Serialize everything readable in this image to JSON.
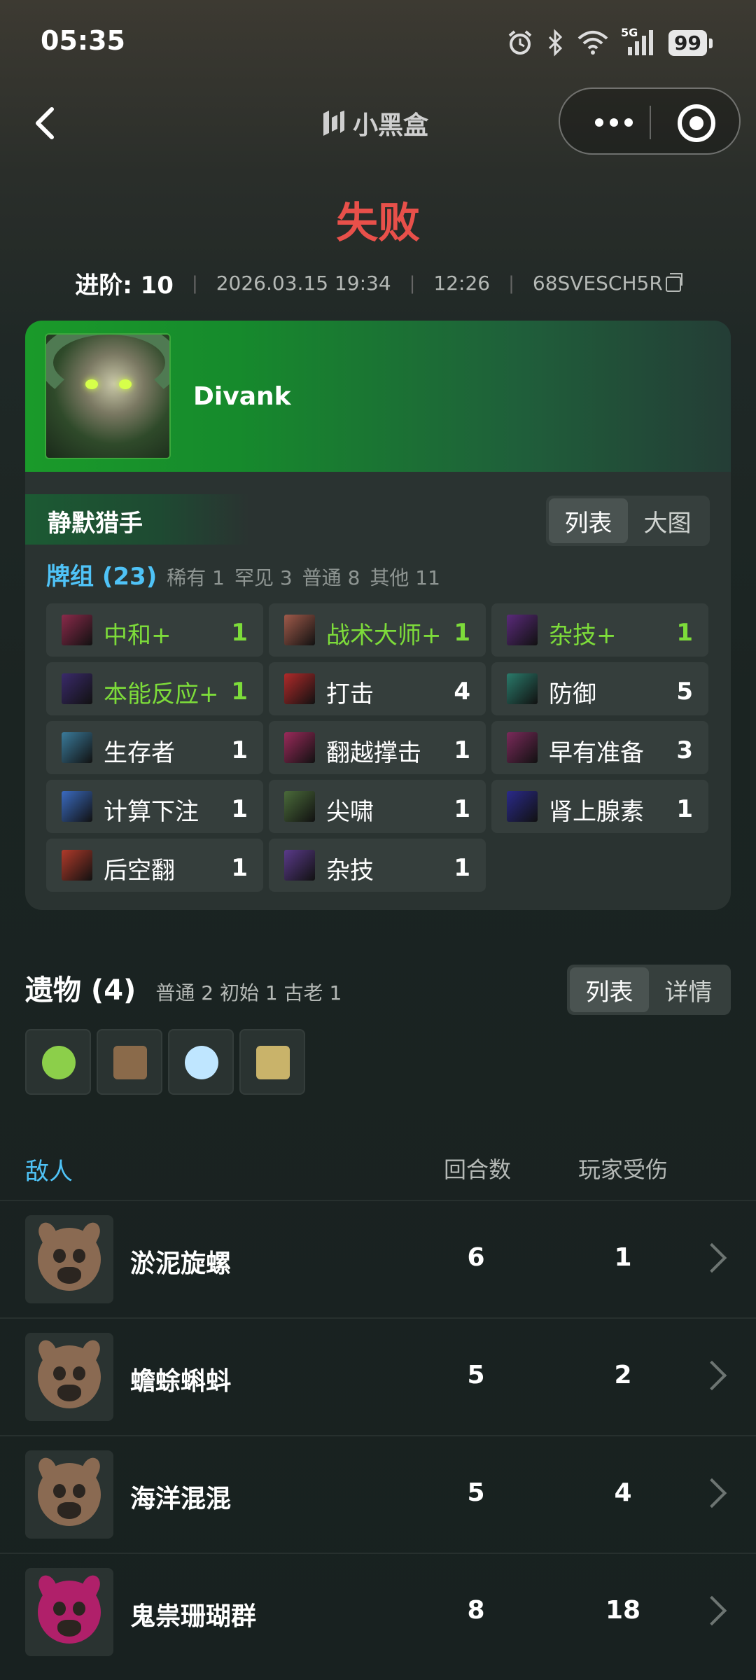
{
  "status": {
    "time": "05:35",
    "battery": "99",
    "network": "5G"
  },
  "nav": {
    "brand": "小黑盒"
  },
  "result": {
    "title": "失败",
    "ascension_label": "进阶: 10",
    "datetime": "2026.03.15 19:34",
    "duration": "12:26",
    "seed": "68SVESCH5R"
  },
  "player": {
    "name": "Divank"
  },
  "character": {
    "name": "静默猎手",
    "view_list": "列表",
    "view_big": "大图"
  },
  "deck": {
    "title": "牌组 (23)",
    "stats": [
      "稀有 1",
      "罕见 3",
      "普通 8",
      "其他 11"
    ],
    "cards": [
      {
        "name": "中和+",
        "count": "1",
        "upgraded": true,
        "color": "#8a2a4a"
      },
      {
        "name": "战术大师+",
        "count": "1",
        "upgraded": true,
        "color": "#a05a4a"
      },
      {
        "name": "杂技+",
        "count": "1",
        "upgraded": true,
        "color": "#5a2a7a"
      },
      {
        "name": "本能反应+",
        "count": "1",
        "upgraded": true,
        "color": "#3a2a6a"
      },
      {
        "name": "打击",
        "count": "4",
        "upgraded": false,
        "color": "#b02a2a"
      },
      {
        "name": "防御",
        "count": "5",
        "upgraded": false,
        "color": "#2a7a6a"
      },
      {
        "name": "生存者",
        "count": "1",
        "upgraded": false,
        "color": "#3a7a9a"
      },
      {
        "name": "翻越撑击",
        "count": "1",
        "upgraded": false,
        "color": "#9a2a5a"
      },
      {
        "name": "早有准备",
        "count": "3",
        "upgraded": false,
        "color": "#7a2a5a"
      },
      {
        "name": "计算下注",
        "count": "1",
        "upgraded": false,
        "color": "#3a6ac0"
      },
      {
        "name": "尖啸",
        "count": "1",
        "upgraded": false,
        "color": "#4a6a3a"
      },
      {
        "name": "肾上腺素",
        "count": "1",
        "upgraded": false,
        "color": "#2a2a8a"
      },
      {
        "name": "后空翻",
        "count": "1",
        "upgraded": false,
        "color": "#b03a2a"
      },
      {
        "name": "杂技",
        "count": "1",
        "upgraded": false,
        "color": "#5a3a8a"
      }
    ]
  },
  "relics": {
    "title": "遗物 (4)",
    "stats": "普通 2  初始 1  古老 1",
    "view_list": "列表",
    "view_detail": "详情",
    "items": [
      {
        "icon": "green-ring-relic-icon",
        "color": "#8ccf4a"
      },
      {
        "icon": "leather-pouch-relic-icon",
        "color": "#8a6a4a"
      },
      {
        "icon": "snowflake-relic-icon",
        "color": "#bfe6ff"
      },
      {
        "icon": "newton-cradle-relic-icon",
        "color": "#c9b36a"
      }
    ]
  },
  "enemies": {
    "header": {
      "title": "敌人",
      "rounds": "回合数",
      "damage": "玩家受伤"
    },
    "rows": [
      {
        "name": "淤泥旋螺",
        "rounds": "6",
        "damage": "1",
        "icon": "brown-monster-icon",
        "color": "#8a6a52"
      },
      {
        "name": "蟾蜍蝌蚪",
        "rounds": "5",
        "damage": "2",
        "icon": "brown-monster-icon",
        "color": "#8a6a52"
      },
      {
        "name": "海洋混混",
        "rounds": "5",
        "damage": "4",
        "icon": "brown-monster-icon",
        "color": "#8a6a52"
      },
      {
        "name": "鬼祟珊瑚群",
        "rounds": "8",
        "damage": "18",
        "icon": "elite-monster-icon",
        "color": "#b0206a"
      }
    ]
  }
}
